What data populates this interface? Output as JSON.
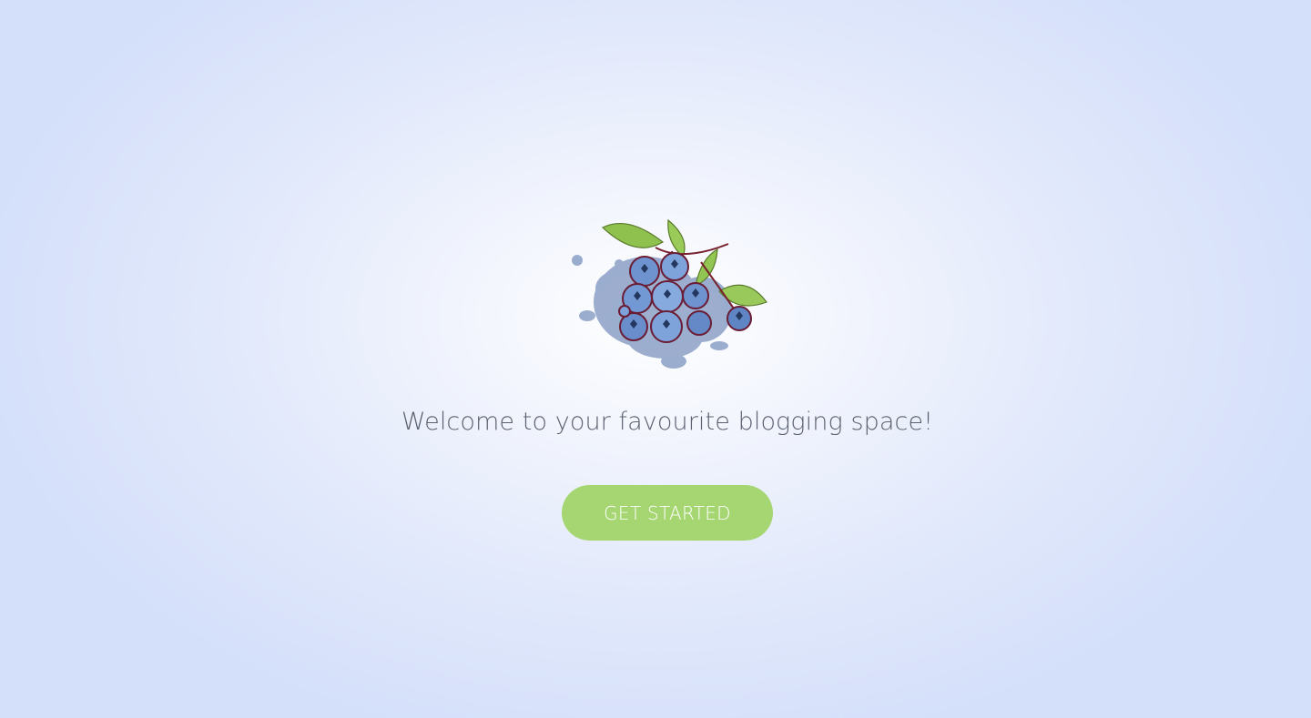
{
  "welcome": {
    "message": "Welcome to your favourite blogging space!"
  },
  "cta": {
    "label": "GET STARTED"
  },
  "logo": {
    "icon": "blueberry-logo-icon"
  },
  "colors": {
    "button": "#a5d672",
    "text": "#5b6170",
    "background": "#d4dffa"
  }
}
